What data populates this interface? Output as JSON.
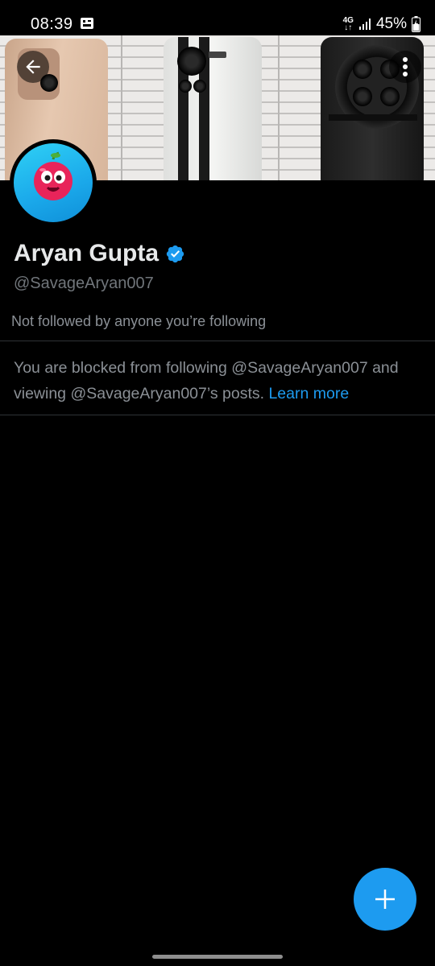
{
  "status_bar": {
    "time": "08:39",
    "network_top": "4G",
    "network_bottom": "↓↑",
    "battery": "45%"
  },
  "header": {
    "back_icon": "arrow-left-icon",
    "menu_icon": "more-vertical-icon"
  },
  "profile": {
    "display_name": "Aryan Gupta",
    "verified_icon": "verified-badge-icon",
    "handle": "@SavageAryan007",
    "followers_note": "Not followed by anyone you’re following",
    "blocked_message": "You are blocked from following @SavageAryan007 and viewing @SavageAryan007’s posts.",
    "learn_more_label": "Learn more"
  },
  "fab": {
    "icon": "plus-icon"
  },
  "colors": {
    "accent": "#1d9bf0",
    "background": "#000000",
    "secondary_text": "#71767b",
    "divider": "#2f3336"
  }
}
